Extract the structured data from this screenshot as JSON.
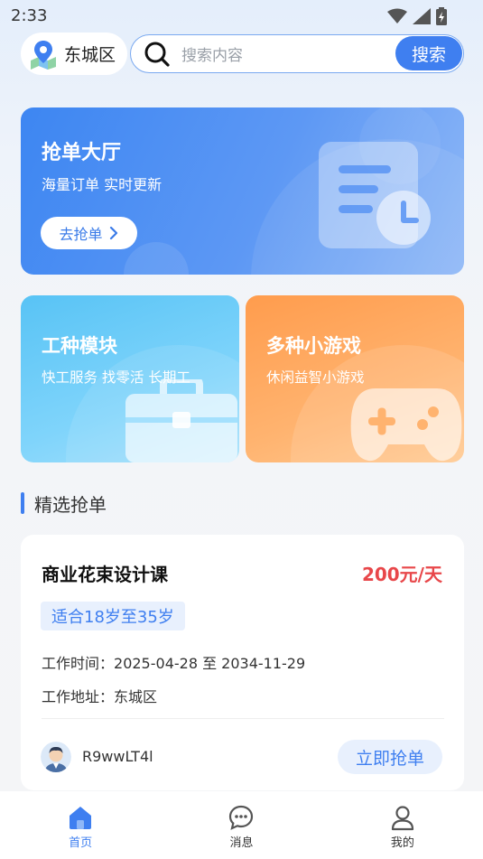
{
  "status_bar": {
    "time": "2:33",
    "icons": [
      "wifi-icon",
      "signal-icon",
      "battery-icon"
    ]
  },
  "header": {
    "location": "东城区",
    "search_placeholder": "搜索内容",
    "search_button": "搜索"
  },
  "hero": {
    "title": "抢单大厅",
    "subtitle": "海量订单 实时更新",
    "button": "去抢单"
  },
  "cards": [
    {
      "title": "工种模块",
      "subtitle": "快工服务 找零活 长期工",
      "icon": "toolbox-icon"
    },
    {
      "title": "多种小游戏",
      "subtitle": "休闲益智小游戏",
      "icon": "gamepad-icon"
    }
  ],
  "section": {
    "title": "精选抢单"
  },
  "job": {
    "title": "商业花束设计课",
    "price": "200元/天",
    "tag": "适合18岁至35岁",
    "time_label": "工作时间：",
    "time_value": "2025-04-28 至 2034-11-29",
    "address_label": "工作地址：",
    "address_value": "东城区",
    "user": "R9wwLT4l",
    "button": "立即抢单"
  },
  "nav": [
    {
      "label": "首页",
      "icon": "home-icon",
      "active": true
    },
    {
      "label": "消息",
      "icon": "message-icon",
      "active": false
    },
    {
      "label": "我的",
      "icon": "profile-icon",
      "active": false
    }
  ],
  "colors": {
    "primary": "#3f7ff0",
    "price": "#e8474a",
    "orange": "#ff9c4d",
    "sky": "#58c3f5"
  }
}
